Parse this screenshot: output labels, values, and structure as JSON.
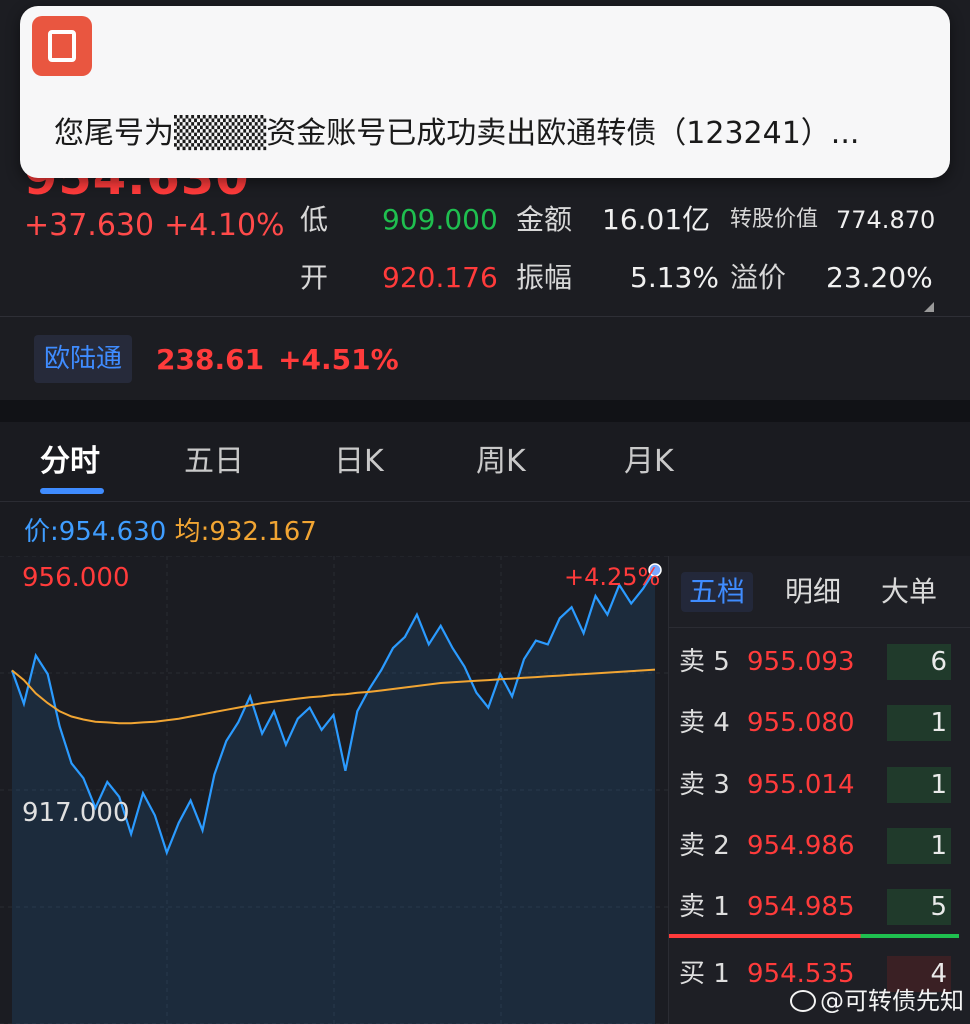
{
  "toast": {
    "text": "您尾号为▒▒▒▒资金账号已成功卖出欧通转债（123241）..."
  },
  "quote": {
    "price": "954.630",
    "change": "+37.630",
    "change_pct": "+4.10%",
    "stats": {
      "low_label": "低",
      "low_value": "909.000",
      "amount_label": "金额",
      "amount_value": "16.01亿",
      "conv_label": "转股价值",
      "conv_value": "774.870",
      "open_label": "开",
      "open_value": "920.176",
      "amp_label": "振幅",
      "amp_value": "5.13%",
      "premium_label": "溢价",
      "premium_value": "23.20%"
    },
    "underlying": {
      "name": "欧陆通",
      "price": "238.61",
      "change_pct": "+4.51%"
    }
  },
  "tabs": [
    "分时",
    "五日",
    "日K",
    "周K",
    "月K"
  ],
  "price_line": {
    "price_label": "价:",
    "price_value": "954.630",
    "avg_label": "均:",
    "avg_value": "932.167"
  },
  "chart_data": {
    "type": "line",
    "ylim": [
      917.0,
      956.0
    ],
    "axis_top_label": "956.000",
    "axis_bottom_label": "917.000",
    "top_pct_label": "+4.25%",
    "colors": {
      "price": "#2b9bff",
      "avg": "#f1a533"
    },
    "series": [
      {
        "key": "price",
        "values": [
          942.5,
          938.0,
          944.5,
          942.0,
          935.0,
          930.0,
          928.0,
          924.0,
          927.5,
          925.5,
          920.5,
          926.0,
          923.0,
          918.0,
          922.0,
          925.0,
          921.0,
          928.5,
          933.0,
          935.5,
          939.0,
          934.0,
          937.0,
          932.5,
          936.0,
          937.5,
          934.5,
          936.5,
          929.0,
          937.0,
          940.0,
          942.5,
          945.5,
          947.0,
          950.0,
          946.0,
          948.5,
          945.5,
          943.0,
          939.5,
          937.5,
          942.0,
          939.0,
          944.0,
          946.5,
          946.0,
          949.5,
          951.0,
          947.5,
          952.5,
          950.0,
          954.0,
          951.5,
          953.5,
          956.0
        ]
      },
      {
        "key": "avg",
        "values": [
          942.5,
          941.2,
          939.4,
          938.1,
          937.0,
          936.3,
          935.9,
          935.6,
          935.5,
          935.4,
          935.4,
          935.5,
          935.6,
          935.8,
          936.0,
          936.3,
          936.6,
          936.9,
          937.2,
          937.5,
          937.8,
          938.1,
          938.3,
          938.5,
          938.7,
          938.9,
          939.0,
          939.2,
          939.3,
          939.5,
          939.6,
          939.8,
          940.0,
          940.2,
          940.4,
          940.6,
          940.8,
          940.9,
          941.0,
          941.1,
          941.2,
          941.3,
          941.4,
          941.5,
          941.6,
          941.7,
          941.8,
          941.9,
          942.0,
          942.1,
          942.2,
          942.3,
          942.4,
          942.5,
          942.6
        ]
      }
    ]
  },
  "book": {
    "tabs": [
      "五档",
      "明细",
      "大单"
    ],
    "asks": [
      {
        "label": "卖 5",
        "price": "955.093",
        "vol": "6",
        "vol_color": "green"
      },
      {
        "label": "卖 4",
        "price": "955.080",
        "vol": "1",
        "vol_color": "green"
      },
      {
        "label": "卖 3",
        "price": "955.014",
        "vol": "1",
        "vol_color": "green"
      },
      {
        "label": "卖 2",
        "price": "954.986",
        "vol": "1",
        "vol_color": "green"
      },
      {
        "label": "卖 1",
        "price": "954.985",
        "vol": "5",
        "vol_color": "green"
      }
    ],
    "bids": [
      {
        "label": "买 1",
        "price": "954.535",
        "vol": "4",
        "vol_color": "red"
      }
    ]
  },
  "watermark": "@可转债先知"
}
